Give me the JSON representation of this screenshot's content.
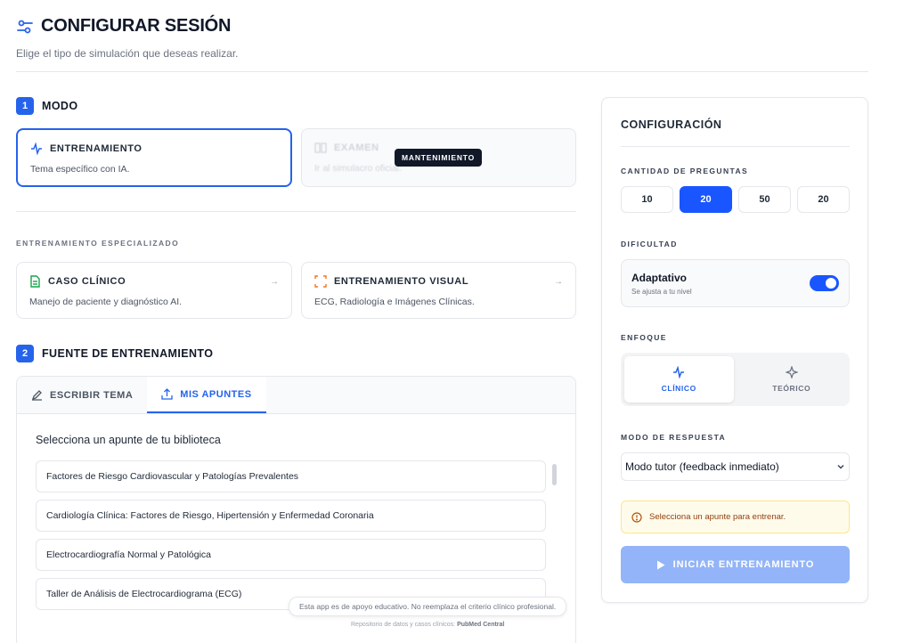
{
  "header": {
    "title": "CONFIGURAR SESIÓN",
    "subtitle": "Elige el tipo de simulación que deseas realizar."
  },
  "mode": {
    "step_number": "1",
    "label": "MODO",
    "cards": [
      {
        "title": "ENTRENAMIENTO",
        "description": "Tema específico con IA.",
        "selected": true,
        "icon": "activity-icon"
      },
      {
        "title": "EXAMEN",
        "description": "Ir al simulacro oficial.",
        "disabled": true,
        "icon": "book-icon",
        "badge": "MANTENIMIENTO"
      }
    ]
  },
  "specialized": {
    "caption": "ENTRENAMIENTO ESPECIALIZADO",
    "cards": [
      {
        "title": "CASO CLÍNICO",
        "description": "Manejo de paciente y diagnóstico AI.",
        "icon": "file-text-icon",
        "arrow": "→"
      },
      {
        "title": "ENTRENAMIENTO VISUAL",
        "description": "ECG, Radiología e Imágenes Clínicas.",
        "icon": "scan-icon",
        "arrow": "→"
      }
    ]
  },
  "source": {
    "step_number": "2",
    "label": "FUENTE DE ENTRENAMIENTO",
    "tabs": [
      {
        "label": "ESCRIBIR TEMA",
        "icon": "pencil-icon",
        "active": false
      },
      {
        "label": "MIS APUNTES",
        "icon": "upload-icon",
        "active": true
      }
    ],
    "library_title": "Selecciona un apunte de tu biblioteca",
    "notes": [
      "Factores de Riesgo Cardiovascular y Patologías Prevalentes",
      "Cardiología Clínica: Factores de Riesgo, Hipertensión y Enfermedad Coronaria",
      "Electrocardiografía Normal y Patológica",
      "Taller de Análisis de Electrocardiograma (ECG)"
    ]
  },
  "footer": {
    "disclaimer": "Esta app es de apoyo educativo. No reemplaza el criterio clínico profesional.",
    "repo_prefix": "Repositorio de datos y casos clínicos:",
    "repo_source": "PubMed Central"
  },
  "config": {
    "title": "CONFIGURACIÓN",
    "quantity": {
      "caption": "CANTIDAD DE PREGUNTAS",
      "options": [
        "10",
        "20",
        "50",
        "20"
      ],
      "selected_index": 1
    },
    "difficulty": {
      "caption": "DIFICULTAD",
      "title": "Adaptativo",
      "subtitle": "Se ajusta a tu nivel",
      "toggle_on": true
    },
    "focus": {
      "caption": "ENFOQUE",
      "options": [
        {
          "label": "CLÍNICO",
          "icon": "activity-icon",
          "active": true
        },
        {
          "label": "TEÓRICO",
          "icon": "sparkles-icon",
          "active": false
        }
      ]
    },
    "response_mode": {
      "caption": "MODO DE RESPUESTA",
      "value": "Modo tutor (feedback inmediato)"
    },
    "warning": "Selecciona un apunte para entrenar.",
    "start_label": "INICIAR ENTRENAMIENTO"
  },
  "colors": {
    "accent": "#2563eb",
    "accent_strong": "#1a56ff",
    "disabled_button": "#93b4f8",
    "warning_bg": "#fffbeb"
  }
}
